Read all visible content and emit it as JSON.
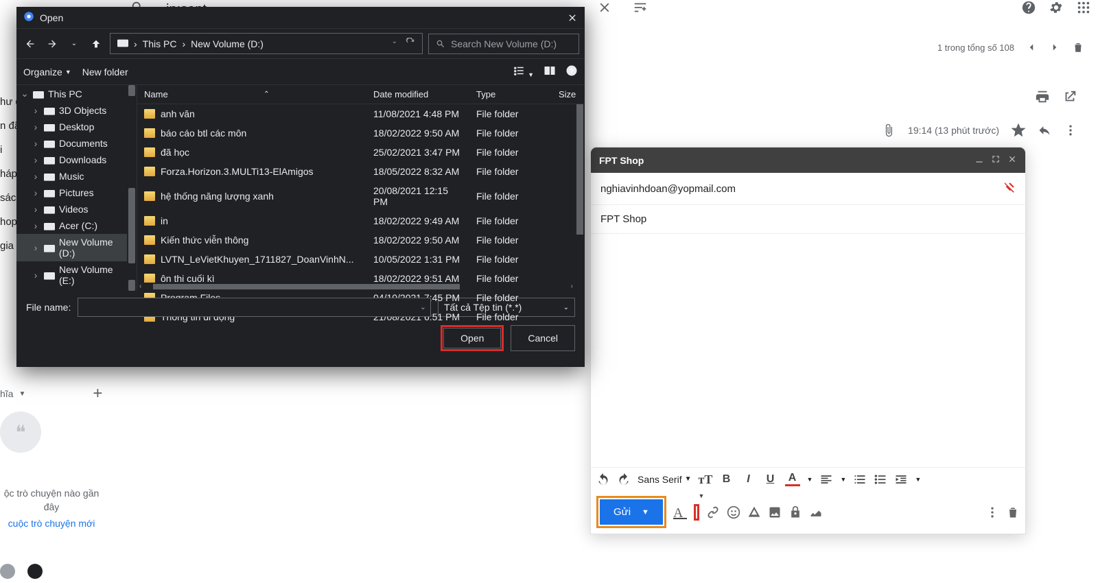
{
  "gmail": {
    "search_placeholder_partial": "in:sent",
    "pagination": "1 trong tổng số 108",
    "msg_time": "19:14 (13 phút trước)",
    "left_labels": [
      "hư đ",
      "n đã",
      "i",
      "háp",
      "sác",
      "hop",
      "gia"
    ],
    "user": "hĩa",
    "no_conv": "ộc trò chuyện nào gần đây",
    "new_conv": "cuộc trò chuyện mới"
  },
  "compose": {
    "title": "FPT Shop",
    "to": "nghiavinhdoan@yopmail.com",
    "subject": "FPT Shop",
    "font": "Sans Serif",
    "send_label": "Gửi"
  },
  "dialog": {
    "title": "Open",
    "path": {
      "root": "This PC",
      "folder": "New Volume (D:)"
    },
    "search_placeholder": "Search New Volume (D:)",
    "organize": "Organize",
    "new_folder": "New folder",
    "cols": {
      "name": "Name",
      "date": "Date modified",
      "type": "Type",
      "size": "Size"
    },
    "tree": [
      {
        "label": "This PC",
        "icon": "pc",
        "depth": 0,
        "expanded": true
      },
      {
        "label": "3D Objects",
        "icon": "3d",
        "depth": 1
      },
      {
        "label": "Desktop",
        "icon": "desktop",
        "depth": 1
      },
      {
        "label": "Documents",
        "icon": "doc",
        "depth": 1
      },
      {
        "label": "Downloads",
        "icon": "dl",
        "depth": 1
      },
      {
        "label": "Music",
        "icon": "music",
        "depth": 1
      },
      {
        "label": "Pictures",
        "icon": "pic",
        "depth": 1
      },
      {
        "label": "Videos",
        "icon": "vid",
        "depth": 1
      },
      {
        "label": "Acer (C:)",
        "icon": "drive",
        "depth": 1
      },
      {
        "label": "New Volume (D:)",
        "icon": "drive",
        "depth": 1,
        "selected": true
      },
      {
        "label": "New Volume (E:)",
        "icon": "drive",
        "depth": 1
      }
    ],
    "files": [
      {
        "name": "anh văn",
        "date": "11/08/2021 4:48 PM",
        "type": "File folder"
      },
      {
        "name": "báo cáo btl các môn",
        "date": "18/02/2022 9:50 AM",
        "type": "File folder"
      },
      {
        "name": "đã học",
        "date": "25/02/2021 3:47 PM",
        "type": "File folder"
      },
      {
        "name": "Forza.Horizon.3.MULTi13-ElAmigos",
        "date": "18/05/2022 8:32 AM",
        "type": "File folder"
      },
      {
        "name": "hệ thống năng lượng xanh",
        "date": "20/08/2021 12:15 PM",
        "type": "File folder"
      },
      {
        "name": "in",
        "date": "18/02/2022 9:49 AM",
        "type": "File folder"
      },
      {
        "name": "Kiến thức viễn thông",
        "date": "18/02/2022 9:50 AM",
        "type": "File folder"
      },
      {
        "name": "LVTN_LeVietKhuyen_1711827_DoanVinhN...",
        "date": "10/05/2022 1:31 PM",
        "type": "File folder"
      },
      {
        "name": "ôn thi cuối kì",
        "date": "18/02/2022 9:51 AM",
        "type": "File folder"
      },
      {
        "name": "Program Files",
        "date": "04/10/2021 7:45 PM",
        "type": "File folder"
      },
      {
        "name": "Thông tin di động",
        "date": "21/08/2021 6:51 PM",
        "type": "File folder"
      }
    ],
    "file_name_label": "File name:",
    "filter": "Tất cả Tệp tin (*.*)",
    "open_btn": "Open",
    "cancel_btn": "Cancel"
  }
}
